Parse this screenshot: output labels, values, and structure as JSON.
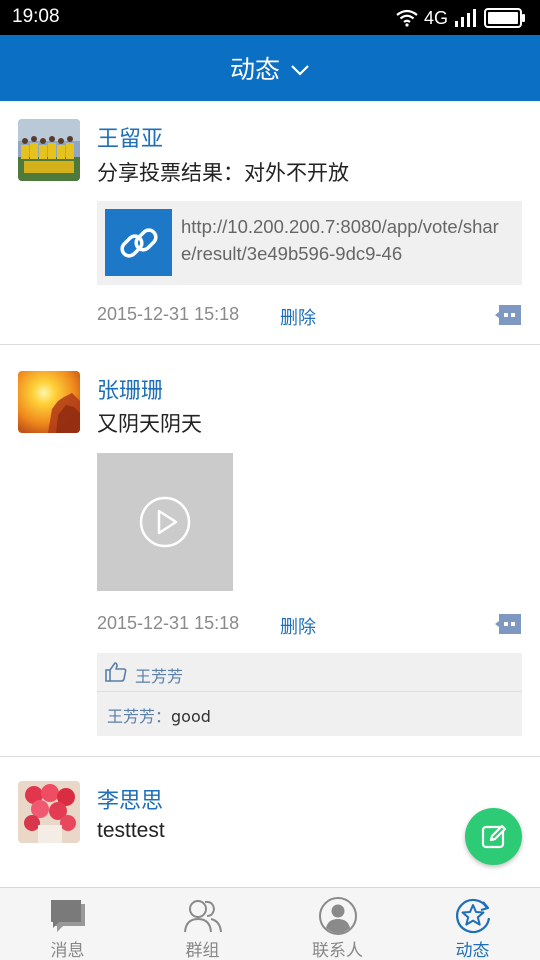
{
  "status_bar": {
    "time": "19:08",
    "network": "4G"
  },
  "header": {
    "title": "动态"
  },
  "posts": [
    {
      "author": "王留亚",
      "text": "分享投票结果：对外不开放",
      "link_url": "http://10.200.200.7:8080/app/vote/share/result/3e49b596-9dc9-46",
      "timestamp": "2015-12-31 15:18",
      "delete_label": "删除"
    },
    {
      "author": "张珊珊",
      "text": "又阴天阴天",
      "timestamp": "2015-12-31 15:18",
      "delete_label": "删除",
      "likes": "王芳芳",
      "comment": {
        "author": "王芳芳：",
        "text": "good"
      }
    },
    {
      "author": "李思思",
      "text": "testtest"
    }
  ],
  "bottom_nav": [
    {
      "label": "消息",
      "icon": "chat-icon"
    },
    {
      "label": "群组",
      "icon": "group-icon"
    },
    {
      "label": "联系人",
      "icon": "contact-icon"
    },
    {
      "label": "动态",
      "icon": "star-refresh-icon"
    }
  ],
  "colors": {
    "header": "#0b6fc3",
    "accent": "#1f6fb8",
    "fab": "#2ecb77",
    "link_icon": "#1e78c8"
  }
}
